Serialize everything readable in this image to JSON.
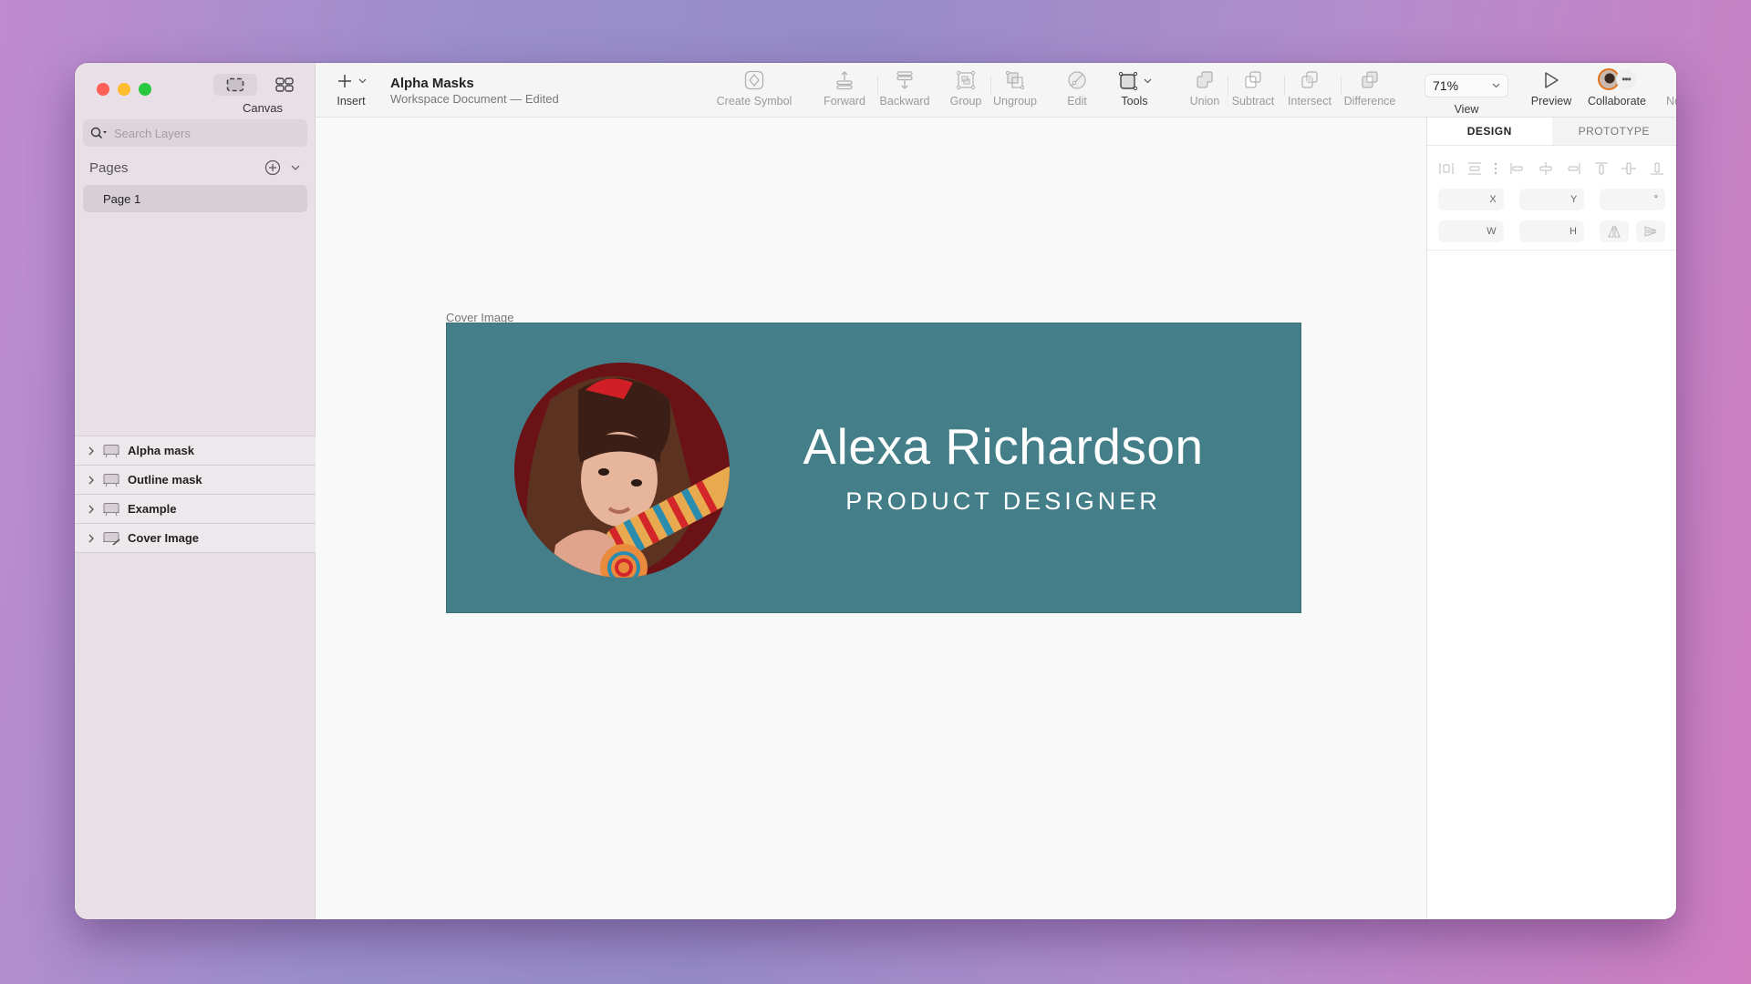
{
  "window": {
    "traffic_lights": {
      "close_color": "#fe5f57",
      "minimize_color": "#febc2e",
      "zoom_color": "#28c840"
    }
  },
  "sidebar": {
    "view_switch_label": "Canvas",
    "search_placeholder": "Search Layers",
    "pages_title": "Pages",
    "pages": [
      {
        "label": "Page 1",
        "selected": true
      }
    ],
    "layers": [
      {
        "name": "Alpha mask",
        "icon": "artboard-icon"
      },
      {
        "name": "Outline mask",
        "icon": "artboard-icon"
      },
      {
        "name": "Example",
        "icon": "artboard-icon"
      },
      {
        "name": "Cover Image",
        "icon": "artboard-edit-icon"
      }
    ]
  },
  "toolbar": {
    "insert_label": "Insert",
    "document_name": "Alpha Masks",
    "document_status": "Workspace Document — Edited",
    "create_symbol": "Create Symbol",
    "forward": "Forward",
    "backward": "Backward",
    "group": "Group",
    "ungroup": "Ungroup",
    "edit": "Edit",
    "tools": "Tools",
    "union": "Union",
    "subtract": "Subtract",
    "intersect": "Intersect",
    "difference": "Difference",
    "zoom_value": "71%",
    "view": "View",
    "preview": "Preview",
    "collaborate": "Collaborate",
    "collaborate_accent": "#e4731c",
    "notifications": "Notifications"
  },
  "canvas": {
    "artboard_label": "Cover Image",
    "artboard_bg": "#447f89",
    "name": "Alexa Richardson",
    "job_title": "PRODUCT DESIGNER"
  },
  "inspector": {
    "tabs": [
      {
        "label": "DESIGN",
        "active": true
      },
      {
        "label": "PROTOTYPE",
        "active": false
      }
    ],
    "fields": {
      "x": "X",
      "y": "Y",
      "rotation": "°",
      "w": "W",
      "h": "H"
    }
  }
}
